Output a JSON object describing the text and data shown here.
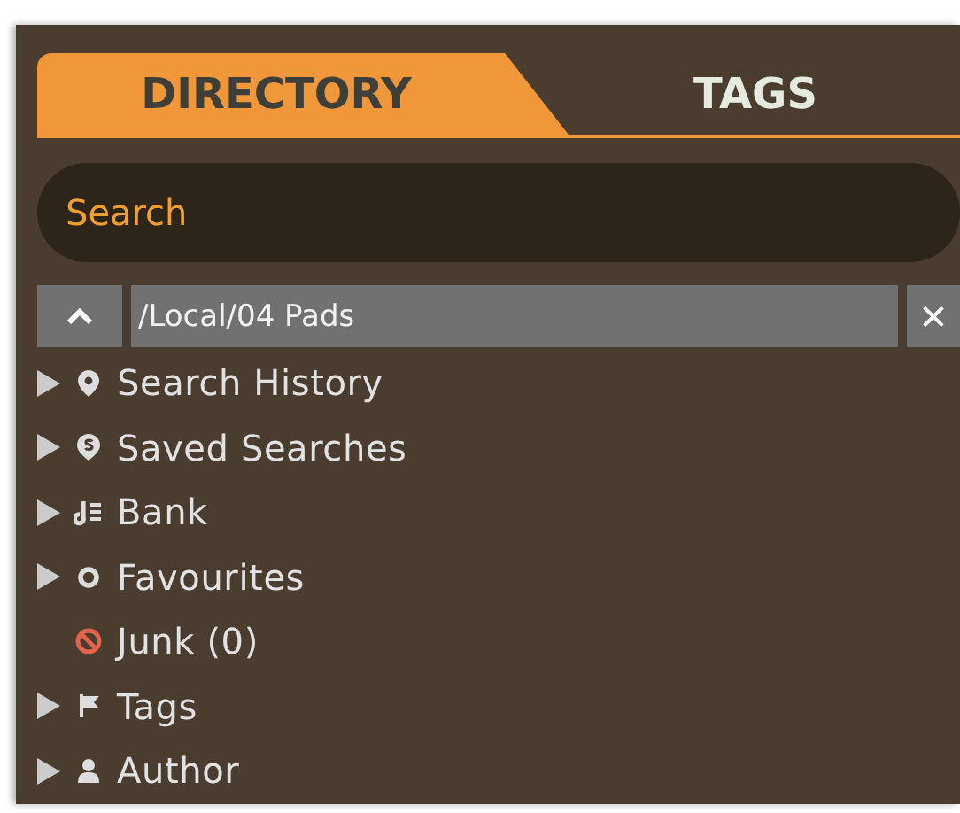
{
  "tabs": [
    {
      "label": "DIRECTORY",
      "selected": true
    },
    {
      "label": "TAGS",
      "selected": false
    }
  ],
  "search": {
    "placeholder": "Search"
  },
  "path_bar": {
    "path": "/Local/04 Pads",
    "clear_button": "✕"
  },
  "tree": [
    {
      "label": "Search History",
      "kind": "pin",
      "expandable": true
    },
    {
      "label": "Saved Searches",
      "kind": "saved",
      "expandable": true
    },
    {
      "label": "Bank",
      "kind": "bank",
      "expandable": true
    },
    {
      "label": "Favourites",
      "kind": "ring",
      "expandable": true
    },
    {
      "label": "Junk (0)",
      "kind": "junk",
      "expandable": false
    },
    {
      "label": "Tags",
      "kind": "flag",
      "expandable": true
    },
    {
      "label": "Author",
      "kind": "person",
      "expandable": true
    }
  ]
}
